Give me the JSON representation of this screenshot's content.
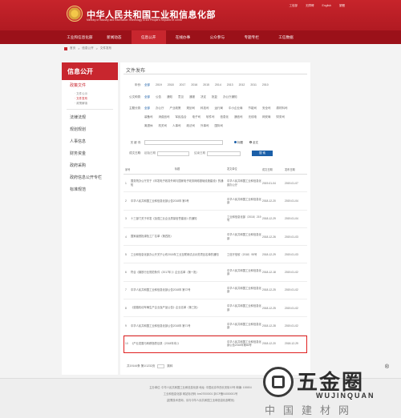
{
  "header": {
    "title": "中华人民共和国工业和信息化部",
    "subtitle": "Ministry of Industry and Information Technology of the People's Republic of China",
    "top_links": [
      "工信部",
      "无障碍",
      "English",
      "繁體"
    ]
  },
  "nav": {
    "items": [
      "工业和信息化部",
      "新闻动态",
      "信息公开",
      "在线办事",
      "公众参与",
      "专题专栏",
      "工信数据"
    ],
    "active_index": 2
  },
  "breadcrumb": [
    "首页",
    ">",
    "信息公开",
    ">",
    "文件发布"
  ],
  "sidebar": {
    "heading": "信息公开",
    "items": [
      {
        "label": "政策文件",
        "active": true
      },
      {
        "label": "法律法规"
      },
      {
        "label": "规划规划"
      },
      {
        "label": "人事信息"
      },
      {
        "label": "财务资金"
      },
      {
        "label": "政府采购"
      },
      {
        "label": "政府信息公开专栏"
      },
      {
        "label": "标准规范"
      }
    ],
    "sub_items": [
      "· 文件公示",
      "· 文件发布",
      "· 政策解读"
    ]
  },
  "main": {
    "title": "文件发布",
    "filters": {
      "year": {
        "label": "年份:",
        "options": [
          "全部",
          "2019",
          "2018",
          "2017",
          "2016",
          "2015",
          "2014",
          "2013",
          "2012",
          "2011",
          "2010"
        ]
      },
      "category": {
        "label": "公文种类:",
        "options": [
          "全部",
          "公告",
          "通知",
          "意见",
          "通报",
          "决定",
          "批复",
          "办公厅通知"
        ]
      },
      "theme_row1": {
        "label": "主题分类:",
        "options": [
          "全部",
          "办公厅",
          "产业政策",
          "规划司",
          "科技司",
          "运行局",
          "中小企业局",
          "节能司",
          "安全司",
          "原材料司"
        ]
      },
      "theme_row2": {
        "label": "",
        "options": [
          "装备司",
          "消费品司",
          "军民结合",
          "电子司",
          "软件司",
          "信息化",
          "通信司",
          "无线电",
          "网安局",
          "财务司"
        ]
      },
      "theme_row3": {
        "label": "",
        "options": [
          "离退休",
          "机关司",
          "人事司",
          "政法司",
          "外事司",
          "国际司"
        ]
      }
    },
    "search": {
      "keyword_label": "关 键 词:",
      "scope_label": "标题",
      "scope_all_label": "全文",
      "date_label": "成文日期:",
      "date_from_placeholder": "起始日期",
      "date_to_label": "结束日期",
      "button": "搜 索"
    },
    "table": {
      "headers": [
        "序号",
        "标题",
        "发文单位",
        "成文日期",
        "发布日期"
      ],
      "rows": [
        {
          "idx": "1",
          "title": "国务院办公厅关于《印发电子政务外网与国家电子政务网络基础设施建设》的通知",
          "issuer": "中华人民共和国工业和信息化部办公厅",
          "date": "2019-01-04",
          "pub": "2019-01-07"
        },
        {
          "idx": "2",
          "title": "中华人民共和国工业和信息化部公告2018年 第3号",
          "issuer": "中华人民共和国工业和信息化部",
          "date": "2018-12-20",
          "pub": "2019-01-04"
        },
        {
          "idx": "3",
          "title": "十三部门关于印发《加强工业企业质量信誉建设》的通知",
          "issuer": "工业和信息化部〔2018〕219号",
          "date": "2018-12-29",
          "pub": "2019-01-04"
        },
        {
          "idx": "4",
          "title": "国家级首批绿色工厂名单（第四批）",
          "issuer": "中华人民共和国工业和信息化部",
          "date": "2018-12-26",
          "pub": "2019-01-03"
        },
        {
          "idx": "5",
          "title": "工业和信息化部办公厅关于公布2018年工业互联网试点示范项目名单的通知",
          "issuer": "工信厅信软〔2018〕95号",
          "date": "2018-12-29",
          "pub": "2019-01-03"
        },
        {
          "idx": "6",
          "title": "符合《钢铁行业规范条件（2017年）》企业名单（第一批）",
          "issuer": "中华人民共和国工业和信息化部",
          "date": "2018-12-18",
          "pub": "2019-01-02"
        },
        {
          "idx": "7",
          "title": "中华人民共和国工业和信息化部公告2018年 第72号",
          "issuer": "中华人民共和国工业和信息化部",
          "date": "2018-12-25",
          "pub": "2019-01-02"
        },
        {
          "idx": "8",
          "title": "《道路机动车辆生产企业及产品公告》企业名单（第三批）",
          "issuer": "中华人民共和国工业和信息化部",
          "date": "2018-12-25",
          "pub": "2019-01-02"
        },
        {
          "idx": "9",
          "title": "中华人民共和国工业和信息化部公告2018年 第71号",
          "issuer": "中华人民共和国工业和信息化部",
          "date": "2018-12-28",
          "pub": "2019-01-02"
        },
        {
          "idx": "10",
          "title": "《产业发展与转移指导目录（2018年本）》",
          "issuer": "中华人民共和国工业和信息化部公告2018年第66号",
          "date": "2018-12-20",
          "pub": "2018-12-29",
          "highlight": true
        }
      ]
    },
    "pager": {
      "text": "共19144条 第1/1232页",
      "go": "跳转"
    }
  },
  "footer": {
    "line1": "主办单位: 中华人民共和国工业和信息化部 地址: 中国北京市西长安街13号 邮编: 100804",
    "line2": "工业和信息化部 网站标识码: bm07000001 京ICP备04000001号",
    "line3": "(如需技术咨询，请与中华人民共和国工业和信息化部联系)"
  },
  "watermark": {
    "cn": "五金圈",
    "en": "WUJINQUAN",
    "sub": "中国建材网",
    "reg": "®"
  }
}
